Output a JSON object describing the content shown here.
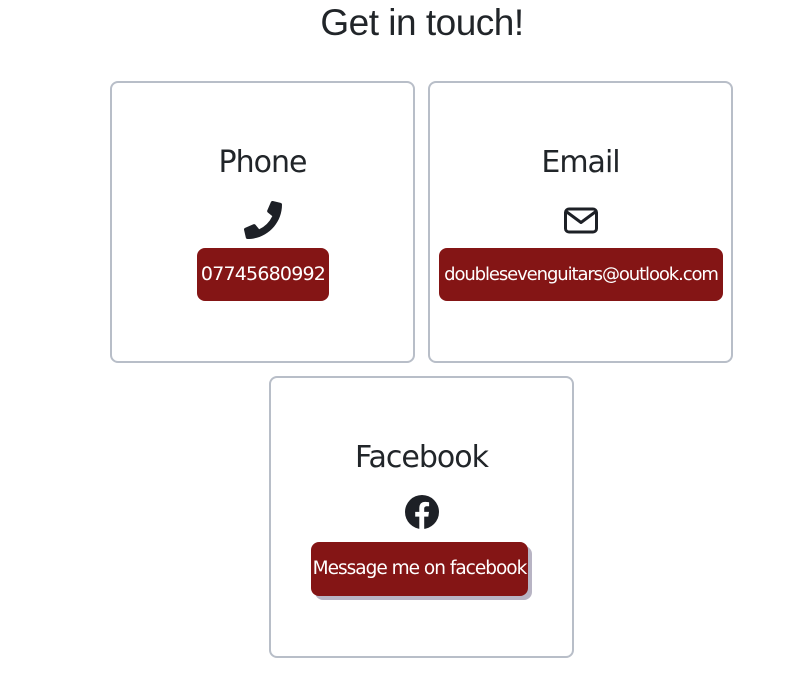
{
  "page": {
    "title": "Get in touch!"
  },
  "cards": {
    "phone": {
      "title": "Phone",
      "icon": "phone-icon",
      "button_label": "07745680992"
    },
    "email": {
      "title": "Email",
      "icon": "envelope-icon",
      "button_label": "doublesevenguitars@outlook.com"
    },
    "facebook": {
      "title": "Facebook",
      "icon": "facebook-icon",
      "button_label": "Message me on facebook"
    }
  },
  "colors": {
    "button_background": "#841515",
    "button_text": "#ffffff",
    "card_border": "#b8bec8",
    "text": "#212529"
  }
}
